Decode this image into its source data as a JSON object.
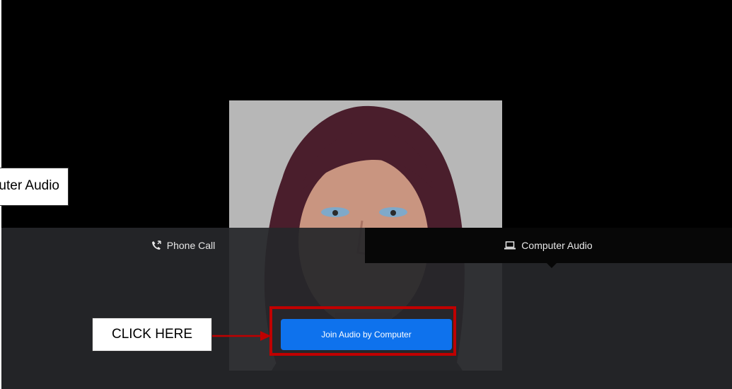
{
  "tabs": {
    "phone_call_label": "Phone Call",
    "computer_audio_label": "Computer Audio",
    "active": "computer_audio"
  },
  "join_button_label": "Join Audio by Computer",
  "annotations": {
    "click_here_label": "CLICK HERE",
    "partial_callout_label": "Computer Audio",
    "highlight_color": "#c00000"
  },
  "colors": {
    "join_button": "#0e72ed",
    "panel_background": "#26272a",
    "active_tab_background": "#070707"
  }
}
